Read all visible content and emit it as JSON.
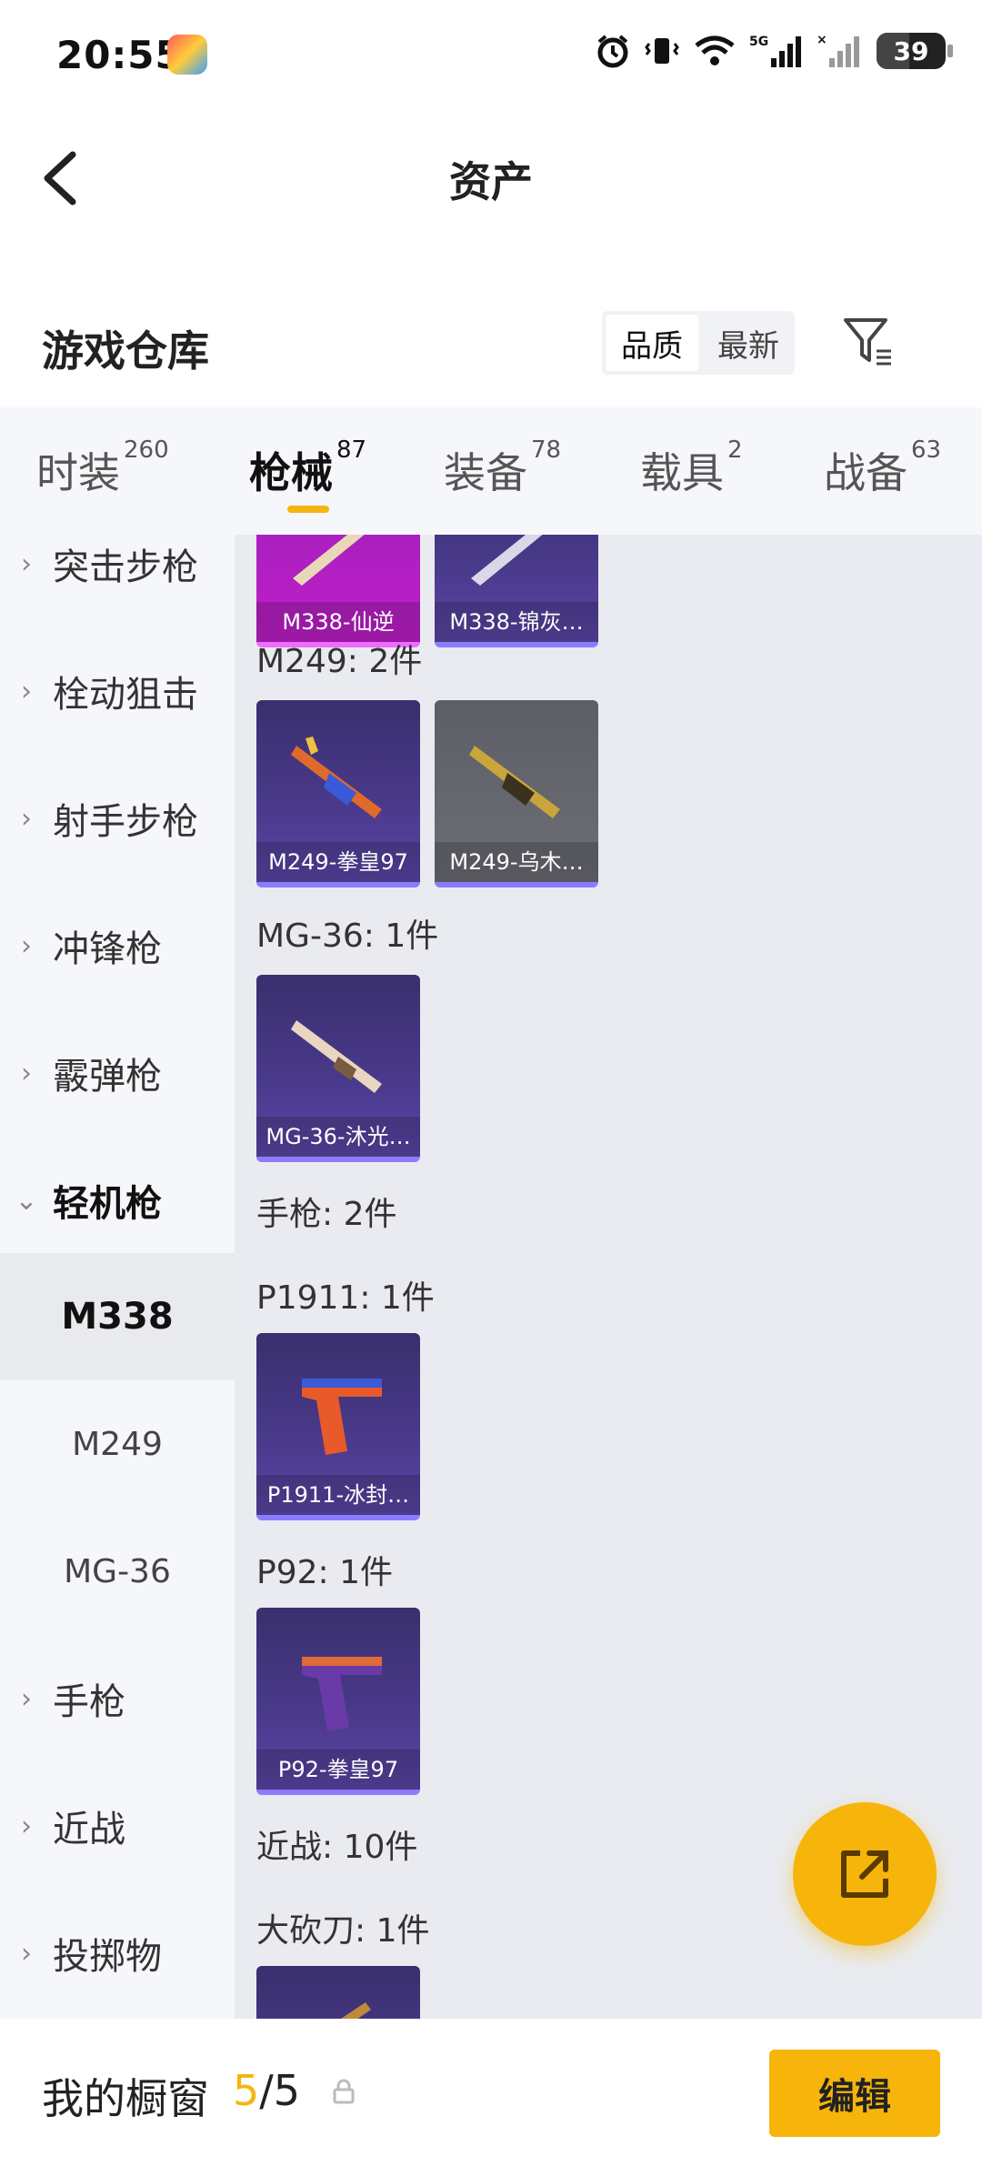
{
  "status": {
    "time": "20:55",
    "battery": "39"
  },
  "header": {
    "title": "资产"
  },
  "section": {
    "title": "游戏仓库",
    "sort_options": [
      "品质",
      "最新"
    ]
  },
  "tabs": [
    {
      "label": "时装",
      "count": "260"
    },
    {
      "label": "枪械",
      "count": "87"
    },
    {
      "label": "装备",
      "count": "78"
    },
    {
      "label": "载具",
      "count": "2"
    },
    {
      "label": "战备",
      "count": "63"
    }
  ],
  "sidebar": {
    "items": [
      {
        "label": "突击步枪",
        "chevron": "›"
      },
      {
        "label": "栓动狙击",
        "chevron": "›"
      },
      {
        "label": "射手步枪",
        "chevron": "›"
      },
      {
        "label": "冲锋枪",
        "chevron": "›"
      },
      {
        "label": "霰弹枪",
        "chevron": "›"
      },
      {
        "label": "轻机枪",
        "chevron": "⌄"
      }
    ],
    "sub_items": [
      "M338",
      "M249",
      "MG-36"
    ],
    "items_after": [
      {
        "label": "手枪",
        "chevron": "›"
      },
      {
        "label": "近战",
        "chevron": "›"
      },
      {
        "label": "投掷物",
        "chevron": "›"
      }
    ]
  },
  "content": {
    "top_cards": [
      "M338-仙逆",
      "M338-锦灰…"
    ],
    "groups": [
      {
        "label": "M249: 2件",
        "cards": [
          "M249-拳皇97",
          "M249-乌木…"
        ]
      },
      {
        "label": "MG-36: 1件",
        "cards": [
          "MG-36-沐光…"
        ]
      },
      {
        "label": "手枪: 2件"
      },
      {
        "label": "P1911: 1件",
        "cards": [
          "P1911-冰封…"
        ]
      },
      {
        "label": "P92: 1件",
        "cards": [
          "P92-拳皇97"
        ]
      },
      {
        "label": "近战: 10件"
      },
      {
        "label": "大砍刀: 1件"
      }
    ]
  },
  "bottom": {
    "label": "我的橱窗",
    "current": "5",
    "total": "/5",
    "edit_label": "编辑"
  },
  "colors": {
    "accent": "#f7b40b",
    "card_purple": "#4a3a8c",
    "card_pink": "#c01fc9",
    "card_gray": "#6c6d75"
  },
  "icons": [
    "back-arrow-icon",
    "filter-icon",
    "lock-icon",
    "share-icon",
    "alarm-icon",
    "vibrate-icon",
    "wifi-icon",
    "signal-icon"
  ]
}
